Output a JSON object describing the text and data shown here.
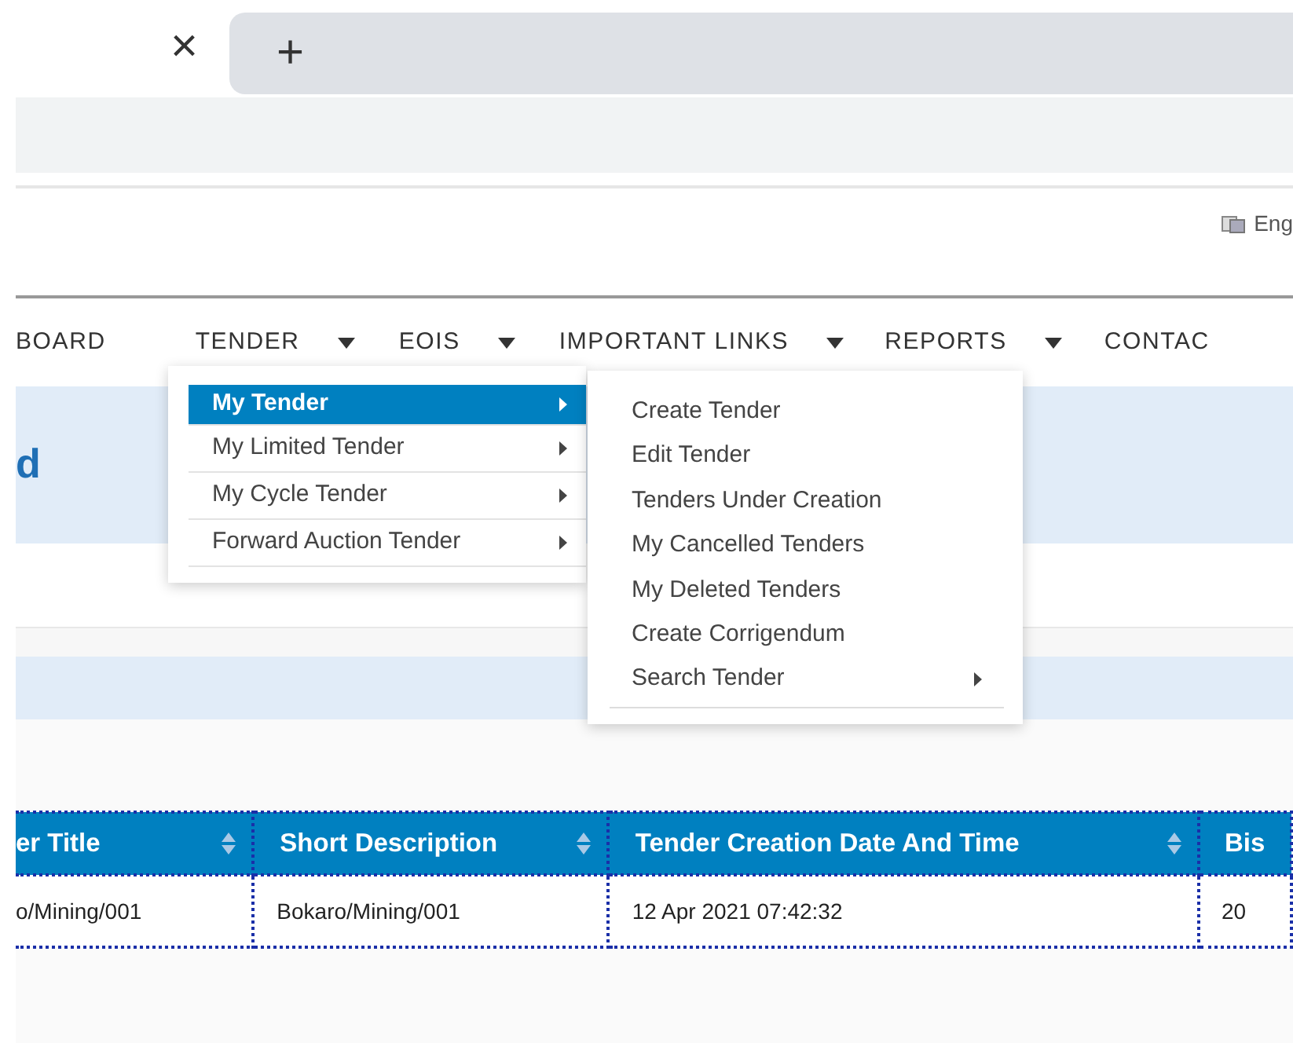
{
  "browser_tabs": {
    "close_label": "×",
    "new_tab_label": "+"
  },
  "language": "Eng",
  "nav": [
    {
      "label": "BOARD",
      "dropdown": false
    },
    {
      "label": "TENDER",
      "dropdown": true
    },
    {
      "label": "EOIS",
      "dropdown": true
    },
    {
      "label": "IMPORTANT LINKS",
      "dropdown": true
    },
    {
      "label": "REPORTS",
      "dropdown": true
    },
    {
      "label": "CONTAC",
      "dropdown": false
    }
  ],
  "page_heading": "d",
  "menu": [
    {
      "label": "My Tender",
      "selected": true,
      "has_submenu": true
    },
    {
      "label": "My Limited Tender",
      "selected": false,
      "has_submenu": true
    },
    {
      "label": "My Cycle Tender",
      "selected": false,
      "has_submenu": true
    },
    {
      "label": "Forward Auction Tender",
      "selected": false,
      "has_submenu": true
    }
  ],
  "submenu": [
    {
      "label": "Create Tender",
      "has_submenu": false
    },
    {
      "label": "Edit Tender",
      "has_submenu": false
    },
    {
      "label": "Tenders Under Creation",
      "has_submenu": false
    },
    {
      "label": "My Cancelled Tenders",
      "has_submenu": false
    },
    {
      "label": "My Deleted Tenders",
      "has_submenu": false
    },
    {
      "label": "Create Corrigendum",
      "has_submenu": false
    },
    {
      "label": "Search Tender",
      "has_submenu": true
    }
  ],
  "table": {
    "columns": [
      {
        "label": "er Title",
        "sortable": true
      },
      {
        "label": "Short Description",
        "sortable": true
      },
      {
        "label": "Tender Creation Date And Time",
        "sortable": true
      },
      {
        "label": "Bis",
        "sortable": false
      }
    ],
    "rows": [
      [
        "o/Mining/001",
        "Bokaro/Mining/001",
        "12 Apr 2021 07:42:32",
        "20"
      ]
    ]
  }
}
